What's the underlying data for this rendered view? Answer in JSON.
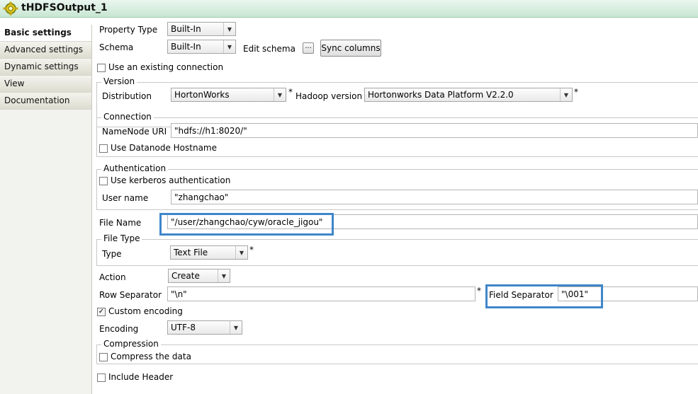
{
  "window": {
    "title": "tHDFSOutput_1"
  },
  "sidebar": {
    "items": [
      {
        "label": "Basic settings"
      },
      {
        "label": "Advanced settings"
      },
      {
        "label": "Dynamic settings"
      },
      {
        "label": "View"
      },
      {
        "label": "Documentation"
      }
    ]
  },
  "form": {
    "property_type": {
      "label": "Property Type",
      "value": "Built-In"
    },
    "schema": {
      "label": "Schema",
      "value": "Built-In",
      "edit_label": "Edit schema",
      "edit_button": "...",
      "sync_button": "Sync columns"
    },
    "use_existing_connection": {
      "label": "Use an existing connection",
      "checked": false
    },
    "version": {
      "legend": "Version",
      "distribution_label": "Distribution",
      "distribution_value": "HortonWorks",
      "hadoop_label": "Hadoop version",
      "hadoop_value": "Hortonworks Data Platform V2.2.0",
      "required_mark": "*"
    },
    "connection": {
      "legend": "Connection",
      "namenode_label": "NameNode URI",
      "namenode_value": "\"hdfs://h1:8020/\"",
      "datanode_label": "Use Datanode Hostname",
      "datanode_checked": false
    },
    "authentication": {
      "legend": "Authentication",
      "kerberos_label": "Use kerberos authentication",
      "kerberos_checked": false,
      "username_label": "User name",
      "username_value": "\"zhangchao\""
    },
    "file_name": {
      "label": "File Name",
      "value": "\"/user/zhangchao/cyw/oracle_jigou\""
    },
    "file_type": {
      "legend": "File Type",
      "type_label": "Type",
      "type_value": "Text File",
      "required_mark": "*"
    },
    "action": {
      "label": "Action",
      "value": "Create"
    },
    "row_separator": {
      "label": "Row Separator",
      "value": "\"\\n\"",
      "required_mark": "*"
    },
    "field_separator": {
      "label": "Field Separator",
      "value": "\"\\001\""
    },
    "custom_encoding": {
      "label": "Custom encoding",
      "checked": true,
      "check_glyph": "✓"
    },
    "encoding": {
      "label": "Encoding",
      "value": "UTF-8"
    },
    "compression": {
      "legend": "Compression",
      "compress_label": "Compress the data",
      "compress_checked": false
    },
    "include_header": {
      "label": "Include Header",
      "checked": false
    }
  },
  "colors": {
    "highlight": "#3f86c9",
    "title_bar": "#d6eedd"
  }
}
